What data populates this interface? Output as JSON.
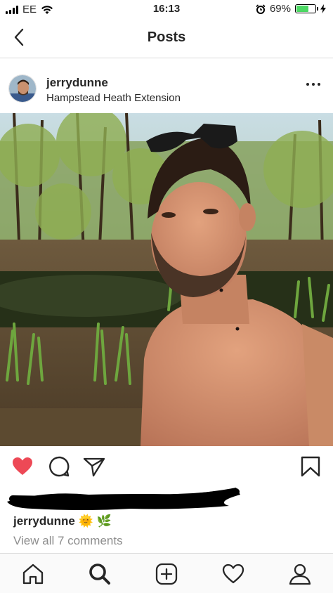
{
  "status_bar": {
    "carrier": "EE",
    "time": "16:13",
    "battery_percent": "69%",
    "battery_level": 0.69,
    "icons": [
      "signal-bars-icon",
      "wifi-icon",
      "alarm-icon",
      "battery-icon",
      "charging-bolt-icon"
    ]
  },
  "nav": {
    "title": "Posts",
    "back_icon": "chevron-left-icon"
  },
  "post": {
    "username": "jerrydunne",
    "location": "Hampstead Heath Extension",
    "more_icon": "more-horizontal-icon",
    "photo_description_icon": "post-photo",
    "actions": {
      "like_icon": "heart-filled-icon",
      "comment_icon": "comment-icon",
      "share_icon": "send-icon",
      "save_icon": "bookmark-icon",
      "like_color": "#ed4956"
    },
    "caption_username": "jerrydunne",
    "caption_emojis": "🌞 🌿",
    "view_comments": "View all 7 comments"
  },
  "tab_bar": {
    "items": [
      "home-icon",
      "search-icon",
      "new-post-icon",
      "activity-heart-icon",
      "profile-icon"
    ]
  }
}
